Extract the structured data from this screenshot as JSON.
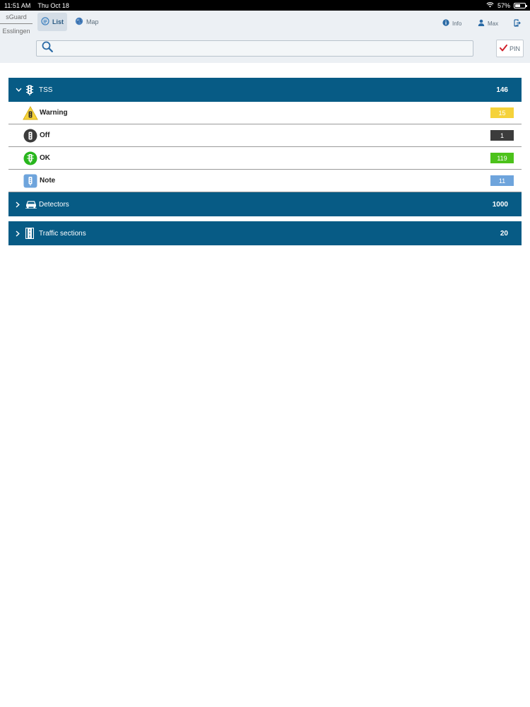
{
  "status_bar": {
    "time": "11:51 AM",
    "date": "Thu Oct 18",
    "battery": "57%",
    "battery_level": 0.57
  },
  "header": {
    "app_name": "sGuard",
    "location": "Esslingen",
    "tabs": [
      {
        "label": "List",
        "icon": "list-icon",
        "active": true
      },
      {
        "label": "Map",
        "icon": "globe-icon",
        "active": false
      }
    ],
    "info_label": "Info",
    "user_label": "Max",
    "logout_icon": "logout-icon",
    "pin_label": "PIN"
  },
  "search": {
    "value": "",
    "placeholder": ""
  },
  "groups": [
    {
      "label": "TSS",
      "count": "146",
      "expanded": true,
      "icon": "traffic-light-icon",
      "items": [
        {
          "label": "Warning",
          "count": "15",
          "color": "#f5d23a",
          "icon": "warning-traffic-light-icon"
        },
        {
          "label": "Off",
          "count": "1",
          "color": "#3c3c3c",
          "icon": "off-traffic-light-icon"
        },
        {
          "label": "OK",
          "count": "119",
          "color": "#4cc21b",
          "icon": "ok-traffic-light-icon"
        },
        {
          "label": "Note",
          "count": "11",
          "color": "#6ea4dc",
          "icon": "note-traffic-light-icon"
        }
      ]
    },
    {
      "label": "Detectors",
      "count": "1000",
      "expanded": false,
      "icon": "car-detector-icon"
    },
    {
      "label": "Traffic sections",
      "count": "20",
      "expanded": false,
      "icon": "road-section-icon"
    }
  ],
  "colors": {
    "group_header": "#075b85",
    "header_bg": "#ecf0f4",
    "accent_check": "#d0202a"
  }
}
